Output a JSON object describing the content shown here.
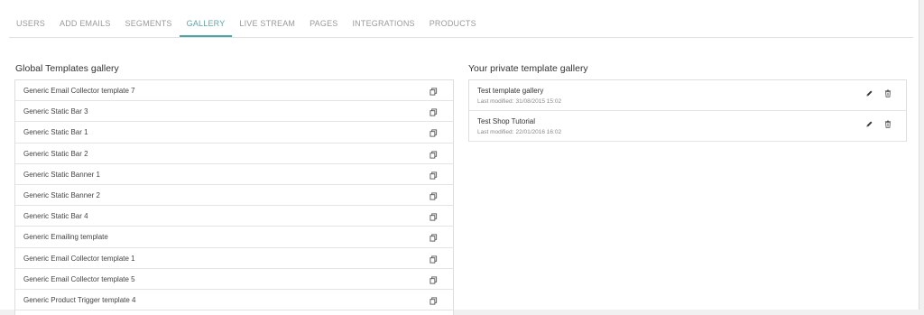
{
  "tabs": [
    {
      "label": "USERS",
      "active": false
    },
    {
      "label": "ADD EMAILS",
      "active": false
    },
    {
      "label": "SEGMENTS",
      "active": false
    },
    {
      "label": "GALLERY",
      "active": true
    },
    {
      "label": "LIVE STREAM",
      "active": false
    },
    {
      "label": "PAGES",
      "active": false
    },
    {
      "label": "INTEGRATIONS",
      "active": false
    },
    {
      "label": "PRODUCTS",
      "active": false
    }
  ],
  "global": {
    "title": "Global Templates gallery",
    "items": [
      {
        "name": "Generic Email Collector template 7"
      },
      {
        "name": "Generic Static Bar 3"
      },
      {
        "name": "Generic Static Bar 1"
      },
      {
        "name": "Generic Static Bar 2"
      },
      {
        "name": "Generic Static Banner 1"
      },
      {
        "name": "Generic Static Banner 2"
      },
      {
        "name": "Generic Static Bar 4"
      },
      {
        "name": "Generic Emailing template"
      },
      {
        "name": "Generic Email Collector template 1"
      },
      {
        "name": "Generic Email Collector template 5"
      },
      {
        "name": "Generic Product Trigger template 4"
      }
    ]
  },
  "private": {
    "title": "Your private template gallery",
    "modified_label": "Last modified:",
    "items": [
      {
        "name": "Test template gallery",
        "modified": "31/08/2015 15:02"
      },
      {
        "name": "Test Shop Tutorial",
        "modified": "22/01/2016 16:02"
      }
    ]
  },
  "colors": {
    "accent": "#4aa6a3",
    "tab_text": "#9a9a9a",
    "border": "#e4e4e4"
  },
  "icons": {
    "copy": "copy-icon",
    "edit": "pencil-icon",
    "delete": "trash-icon"
  }
}
